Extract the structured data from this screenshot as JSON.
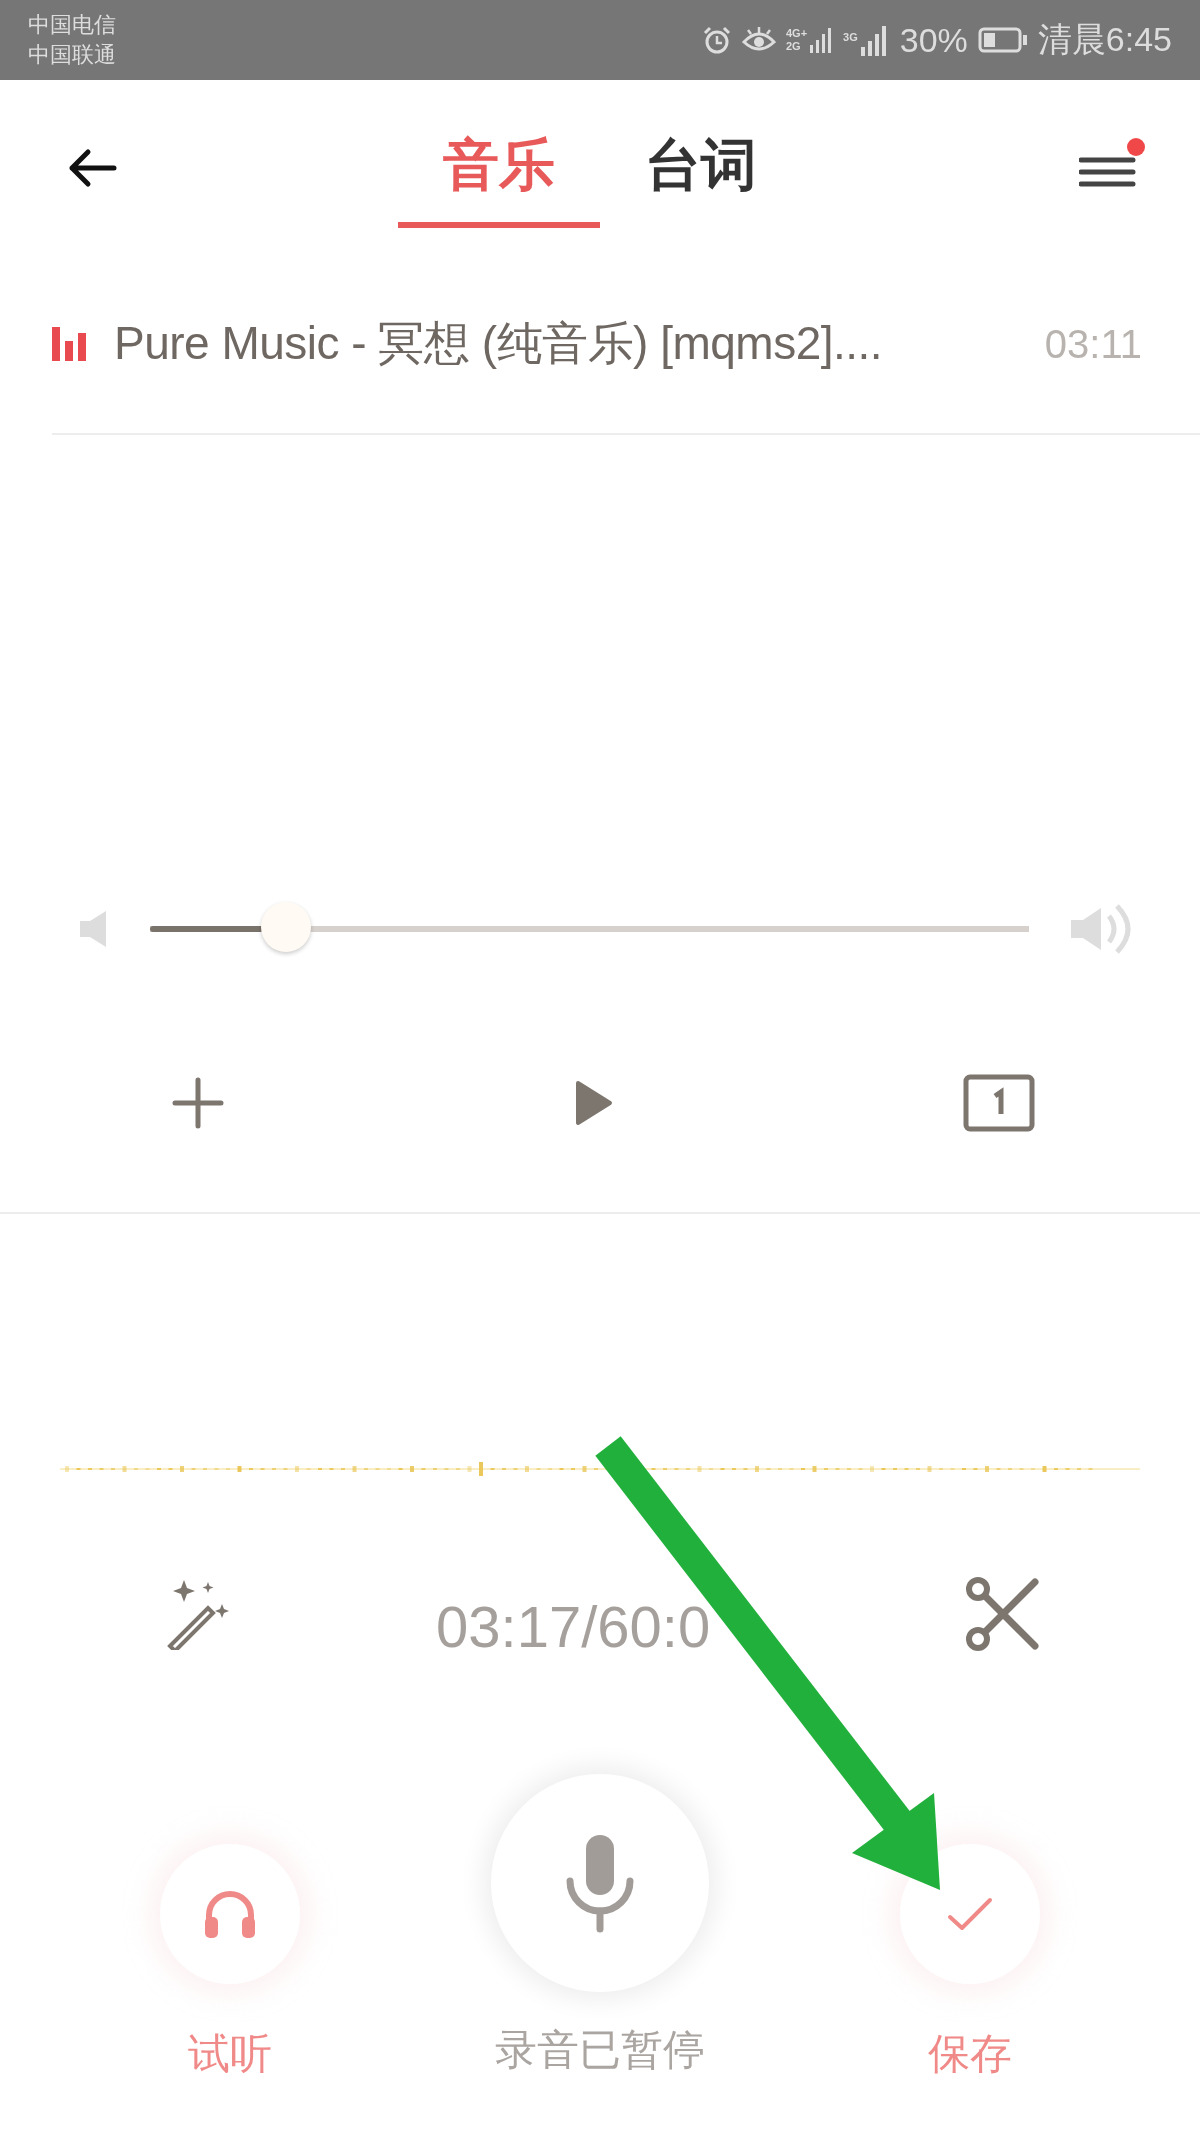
{
  "status_bar": {
    "carriers": [
      "中国电信",
      "中国联通"
    ],
    "sim1_network": [
      "4G+",
      "2G"
    ],
    "sim2_network": "3G",
    "battery": "30%",
    "time": "清晨6:45"
  },
  "header": {
    "tabs": [
      {
        "label": "音乐",
        "selected": true
      },
      {
        "label": "台词",
        "selected": false
      }
    ],
    "menu_has_notification": true
  },
  "track": {
    "title": "Pure Music - 冥想 (纯音乐) [mqms2]....",
    "duration": "03:11"
  },
  "volume": {
    "level": 0.155
  },
  "timer": "03:17/60:0",
  "actions": [
    {
      "kind": "listen",
      "label": "试听"
    },
    {
      "kind": "record",
      "label": "录音已暂停"
    },
    {
      "kind": "save",
      "label": "保存"
    }
  ]
}
